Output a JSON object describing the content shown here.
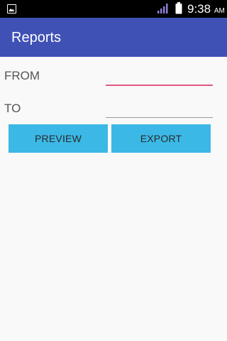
{
  "status_bar": {
    "time": "9:38",
    "ampm": "AM",
    "notification_icon": "image-notification-icon",
    "signal_icon": "signal-strength-icon",
    "battery_icon": "battery-icon"
  },
  "app_bar": {
    "title": "Reports",
    "color": "#3f51b5"
  },
  "form": {
    "from_label": "FROM",
    "from_value": "",
    "to_label": "TO",
    "to_value": ""
  },
  "buttons": {
    "preview_label": "PREVIEW",
    "export_label": "EXPORT",
    "color": "#3bb8e6"
  }
}
